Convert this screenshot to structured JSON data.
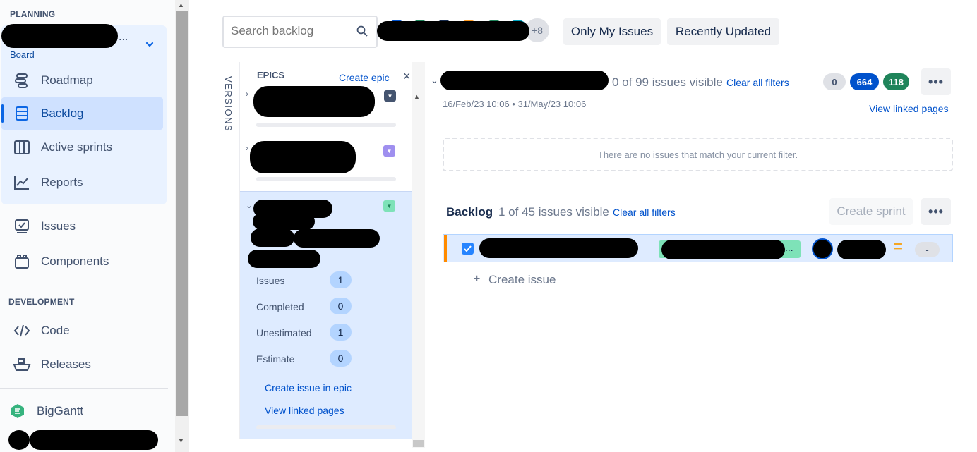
{
  "sidebar": {
    "planning_title": "PLANNING",
    "board_label": "Board",
    "project_ellipsis": "...",
    "items": [
      {
        "label": "Roadmap",
        "icon": "roadmap-icon"
      },
      {
        "label": "Backlog",
        "icon": "backlog-icon"
      },
      {
        "label": "Active sprints",
        "icon": "active-sprints-icon"
      },
      {
        "label": "Reports",
        "icon": "reports-icon"
      },
      {
        "label": "Issues",
        "icon": "issues-icon"
      },
      {
        "label": "Components",
        "icon": "components-icon"
      }
    ],
    "development_title": "DEVELOPMENT",
    "dev_items": [
      {
        "label": "Code",
        "icon": "code-icon"
      },
      {
        "label": "Releases",
        "icon": "releases-icon"
      }
    ],
    "apps": [
      {
        "label": "BigGantt",
        "icon": "biggantt-icon"
      }
    ]
  },
  "toolbar": {
    "search_placeholder": "Search backlog",
    "avatar_more": "+8",
    "only_my_issues": "Only My Issues",
    "recently_updated": "Recently Updated"
  },
  "epics_panel": {
    "versions_label": "VERSIONS",
    "title": "EPICS",
    "create_epic": "Create epic",
    "close": "×",
    "stats": [
      {
        "label": "Issues",
        "value": "1"
      },
      {
        "label": "Completed",
        "value": "0"
      },
      {
        "label": "Unestimated",
        "value": "1"
      },
      {
        "label": "Estimate",
        "value": "0"
      }
    ],
    "create_issue_in_epic": "Create issue in epic",
    "view_linked_pages": "View linked pages"
  },
  "sprint": {
    "issues_visible": "0 of 99 issues visible",
    "clear_filters": "Clear all filters",
    "dates": "16/Feb/23 10:06 • 31/May/23 10:06",
    "counts": [
      "0",
      "664",
      "118"
    ],
    "view_linked_pages": "View linked pages",
    "empty_message": "There are no issues that match your current filter."
  },
  "backlog": {
    "title": "Backlog",
    "issues_visible": "1 of 45 issues visible",
    "clear_filters": "Clear all filters",
    "create_sprint": "Create sprint",
    "create_issue": "Create issue",
    "create_plus": "+",
    "row": {
      "epic_more": "...",
      "priority": "=",
      "estimate": "-"
    }
  },
  "colors": {
    "accent": "#0c66e4",
    "count_blue": "#0052cc",
    "count_green": "#1f845a",
    "epic_dark": "#44546f",
    "epic_purple": "#9f8fef",
    "epic_green": "#7ee2b8",
    "priority": "#f5a623"
  }
}
